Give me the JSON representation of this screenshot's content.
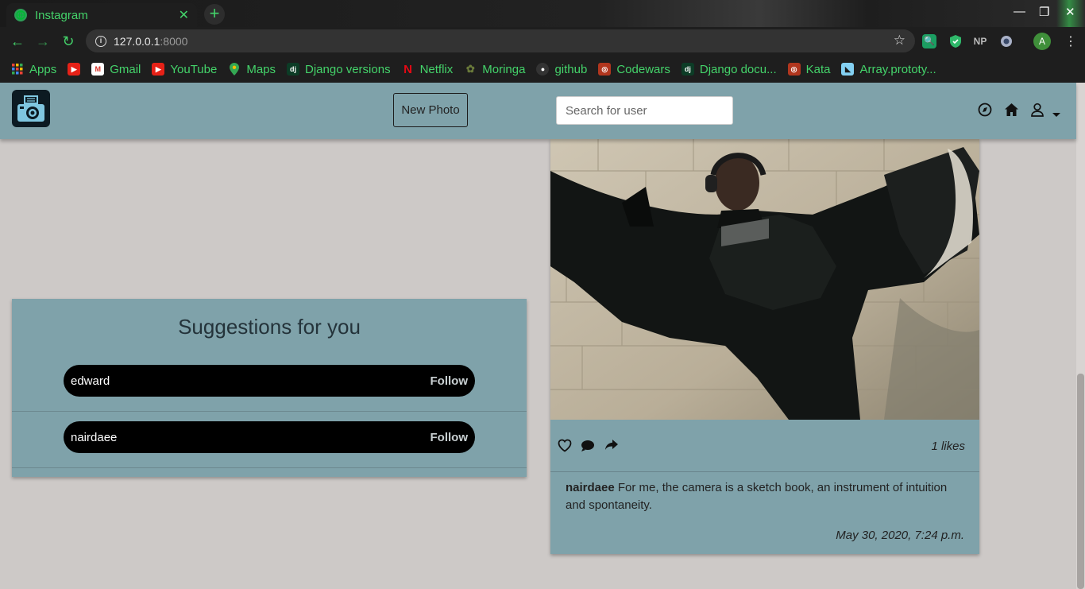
{
  "browser": {
    "tab_title": "Instagram",
    "tab_close": "✕",
    "new_tab": "+",
    "url_host": "127.0.0.1",
    "url_port": ":8000",
    "profile_initial": "A",
    "ext_np": "NP",
    "bookmarks": [
      {
        "label": "Apps",
        "icon": "apps-grid-icon"
      },
      {
        "label": "",
        "icon": "youtube-icon"
      },
      {
        "label": "Gmail",
        "icon": "gmail-icon"
      },
      {
        "label": "YouTube",
        "icon": "youtube-icon"
      },
      {
        "label": "Maps",
        "icon": "maps-icon"
      },
      {
        "label": "Django versions",
        "icon": "django-icon"
      },
      {
        "label": "Netflix",
        "icon": "netflix-icon"
      },
      {
        "label": "Moringa",
        "icon": "moringa-icon"
      },
      {
        "label": "github",
        "icon": "github-icon"
      },
      {
        "label": "Codewars",
        "icon": "codewars-icon"
      },
      {
        "label": "Django docu...",
        "icon": "django-icon"
      },
      {
        "label": "Kata",
        "icon": "codewars-icon"
      },
      {
        "label": "Array.prototy...",
        "icon": "mdn-icon"
      }
    ]
  },
  "navbar": {
    "new_photo_label": "New Photo",
    "search_placeholder": "Search for user"
  },
  "suggestions": {
    "title": "Suggestions for you",
    "users": [
      {
        "name": "edward",
        "action": "Follow"
      },
      {
        "name": "nairdaee",
        "action": "Follow"
      }
    ]
  },
  "post": {
    "likes": "1 likes",
    "author": "nairdaee",
    "caption": "For me, the camera is a sketch book, an instrument of intuition and spontaneity.",
    "date": "May 30, 2020, 7:24 p.m."
  },
  "colors": {
    "accent_green": "#44d36a",
    "card_bg": "#7fa2aa",
    "page_bg": "#cdc9c7"
  }
}
